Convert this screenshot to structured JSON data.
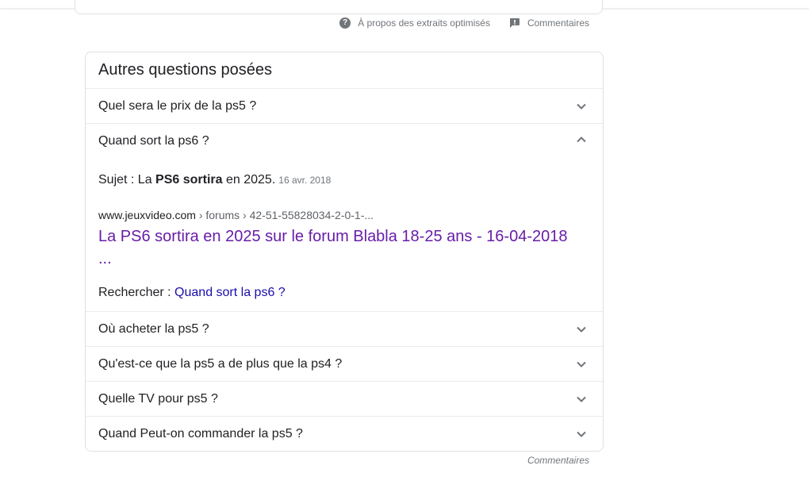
{
  "snippet_footer": {
    "about_label": "À propos des extraits optimisés",
    "feedback_label": "Commentaires"
  },
  "paa": {
    "title": "Autres questions posées",
    "questions": [
      {
        "text": "Quel sera le prix de la ps5 ?",
        "expanded": false
      },
      {
        "text": "Quand sort la ps6 ?",
        "expanded": true
      },
      {
        "text": "Où acheter la ps5 ?",
        "expanded": false
      },
      {
        "text": "Qu'est-ce que la ps5 a de plus que la ps4 ?",
        "expanded": false
      },
      {
        "text": "Quelle TV pour ps5 ?",
        "expanded": false
      },
      {
        "text": "Quand Peut-on commander la ps5 ?",
        "expanded": false
      }
    ],
    "answer": {
      "prefix": "Sujet : La ",
      "bold": "PS6 sortira",
      "suffix": " en 2025.",
      "date": "16 avr. 2018",
      "site": "www.jeuxvideo.com",
      "path": " › forums › 42-51-55828034-2-0-1-...",
      "link_title": "La PS6 sortira en 2025 sur le forum Blabla 18-25 ans - 16-04-2018 ...",
      "search_label": "Rechercher : ",
      "search_query": "Quand sort la ps6 ?"
    }
  },
  "paa_footer": {
    "feedback_label": "Commentaires"
  },
  "colors": {
    "visited_link": "#681da8",
    "link": "#1a0dab",
    "border": "#dfe1e5",
    "muted": "#70757a"
  },
  "icons": {
    "about": "help-circle-icon",
    "feedback": "feedback-flag-icon",
    "expand": "chevron-down-icon",
    "collapse": "chevron-up-icon"
  }
}
